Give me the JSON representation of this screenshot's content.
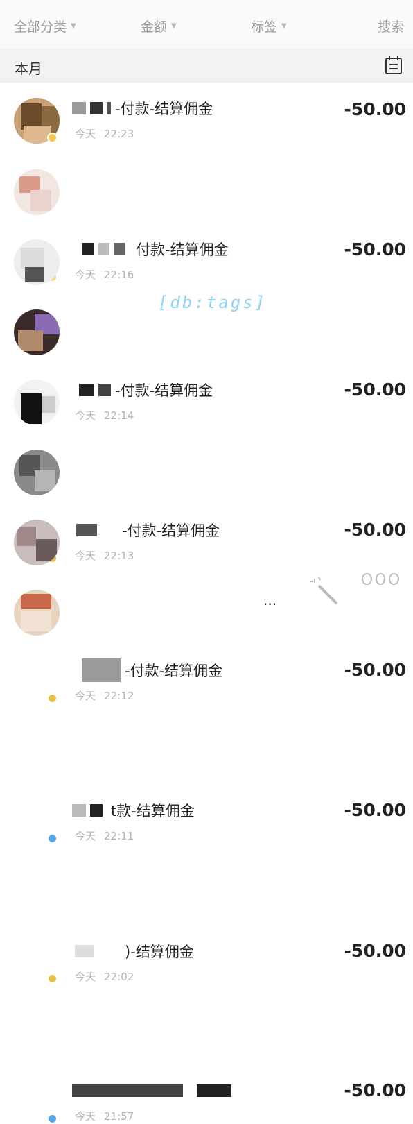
{
  "filters": {
    "category": "全部分类",
    "amount": "金额",
    "tags": "标签",
    "search": "搜索"
  },
  "section": {
    "month": "本月"
  },
  "watermark": "[db:tags]",
  "transactions": [
    {
      "title": "-付款-结算佣金",
      "day": "今天",
      "time": "22:23",
      "amount": "-50.00"
    },
    {
      "title": "付款-结算佣金",
      "day": "今天",
      "time": "22:16",
      "amount": "-50.00"
    },
    {
      "title": "-付款-结算佣金",
      "day": "今天",
      "time": "22:14",
      "amount": "-50.00"
    },
    {
      "title": "-付款-结算佣金",
      "day": "今天",
      "time": "22:13",
      "amount": "-50.00"
    },
    {
      "title": "-付款-结算佣金",
      "day": "今天",
      "time": "22:12",
      "amount": "-50.00"
    },
    {
      "title": "t款-结算佣金",
      "day": "今天",
      "time": "22:11",
      "amount": "-50.00"
    },
    {
      "title": ")-结算佣金",
      "day": "今天",
      "time": "22:02",
      "amount": "-50.00"
    },
    {
      "title": "",
      "trailing": "...",
      "day": "今天",
      "time": "21:57",
      "amount": "-50.00"
    }
  ],
  "icons": {
    "dropdown": "chevron-down-icon",
    "calendar": "calendar-icon",
    "wand": "magic-wand-icon",
    "more": "more-options-icon"
  }
}
